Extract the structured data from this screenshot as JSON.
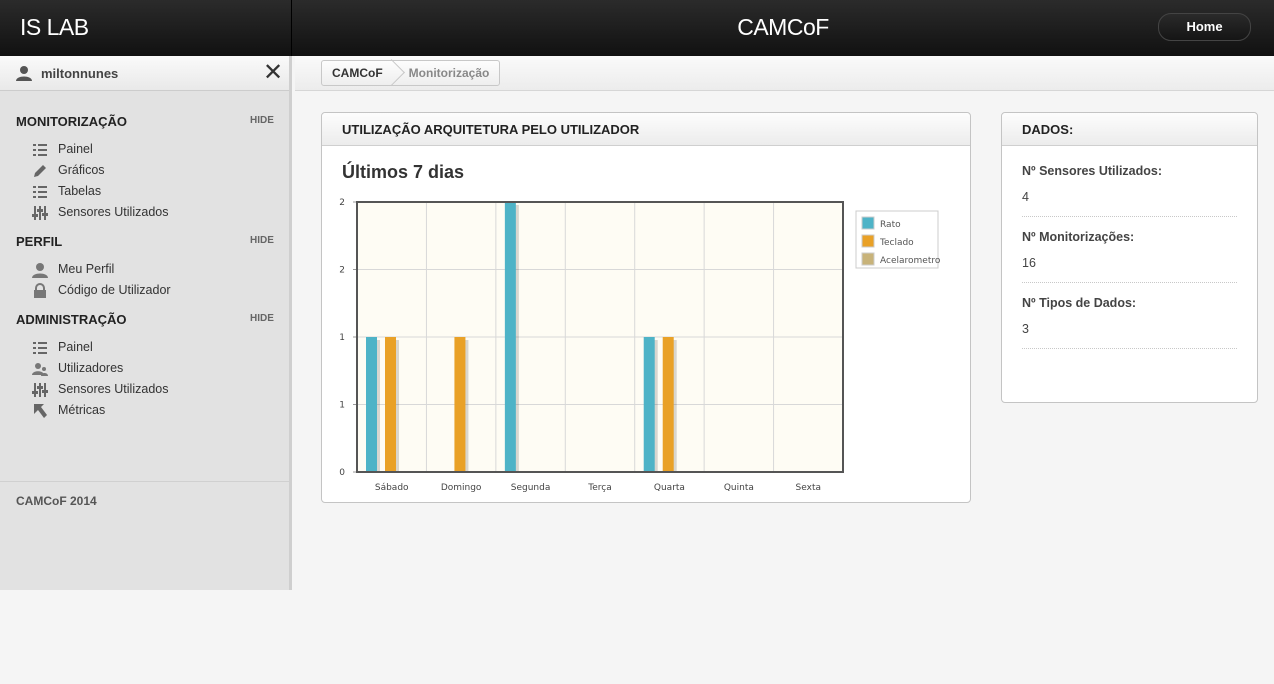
{
  "header": {
    "brand": "IS LAB",
    "title": "CAMCoF",
    "home_label": "Home"
  },
  "user": {
    "name": "miltonnunes"
  },
  "sidebar": {
    "sections": [
      {
        "title": "MONITORIZAÇÃO",
        "hide": "HIDE",
        "items": [
          {
            "label": "Painel",
            "icon": "list-icon"
          },
          {
            "label": "Gráficos",
            "icon": "pencil-icon"
          },
          {
            "label": "Tabelas",
            "icon": "list-icon"
          },
          {
            "label": "Sensores Utilizados",
            "icon": "sliders-icon"
          }
        ]
      },
      {
        "title": "PERFIL",
        "hide": "HIDE",
        "items": [
          {
            "label": "Meu Perfil",
            "icon": "user-icon"
          },
          {
            "label": "Código de Utilizador",
            "icon": "lock-icon"
          }
        ]
      },
      {
        "title": "ADMINISTRAÇÃO",
        "hide": "HIDE",
        "items": [
          {
            "label": "Painel",
            "icon": "list-icon"
          },
          {
            "label": "Utilizadores",
            "icon": "users-icon"
          },
          {
            "label": "Sensores Utilizados",
            "icon": "sliders-icon"
          },
          {
            "label": "Métricas",
            "icon": "cursor-icon"
          }
        ]
      }
    ],
    "footer": "CAMCoF 2014"
  },
  "breadcrumb": {
    "items": [
      "CAMCoF",
      "Monitorização"
    ]
  },
  "chart_panel": {
    "title": "UTILIZAÇÃO ARQUITETURA PELO UTILIZADOR",
    "subtitle": "Últimos 7 dias"
  },
  "dados": {
    "title": "DADOS:",
    "items": [
      {
        "label": "Nº Sensores Utilizados:",
        "value": "4"
      },
      {
        "label": "Nº Monitorizações:",
        "value": "16"
      },
      {
        "label": "Nº Tipos de Dados:",
        "value": "3"
      }
    ]
  },
  "chart_data": {
    "type": "bar",
    "categories": [
      "Sábado",
      "Domingo",
      "Segunda",
      "Terça",
      "Quarta",
      "Quinta",
      "Sexta"
    ],
    "series": [
      {
        "name": "Rato",
        "color": "#4eb3c7",
        "values": [
          1,
          0,
          2,
          0,
          1,
          0,
          0
        ]
      },
      {
        "name": "Teclado",
        "color": "#e9a127",
        "values": [
          1,
          1,
          0,
          0,
          1,
          0,
          0
        ]
      },
      {
        "name": "Acelarometro",
        "color": "#c8b37a",
        "values": [
          0,
          0,
          0,
          0,
          0,
          0,
          0
        ]
      }
    ],
    "y_tick_labels": [
      "0",
      "1",
      "1",
      "2",
      "2"
    ],
    "ylim": [
      0,
      2
    ],
    "grid": true,
    "legend": "right",
    "colors": {
      "plot_bg": "#fefcf4",
      "grid": "#d8d8d8"
    }
  }
}
